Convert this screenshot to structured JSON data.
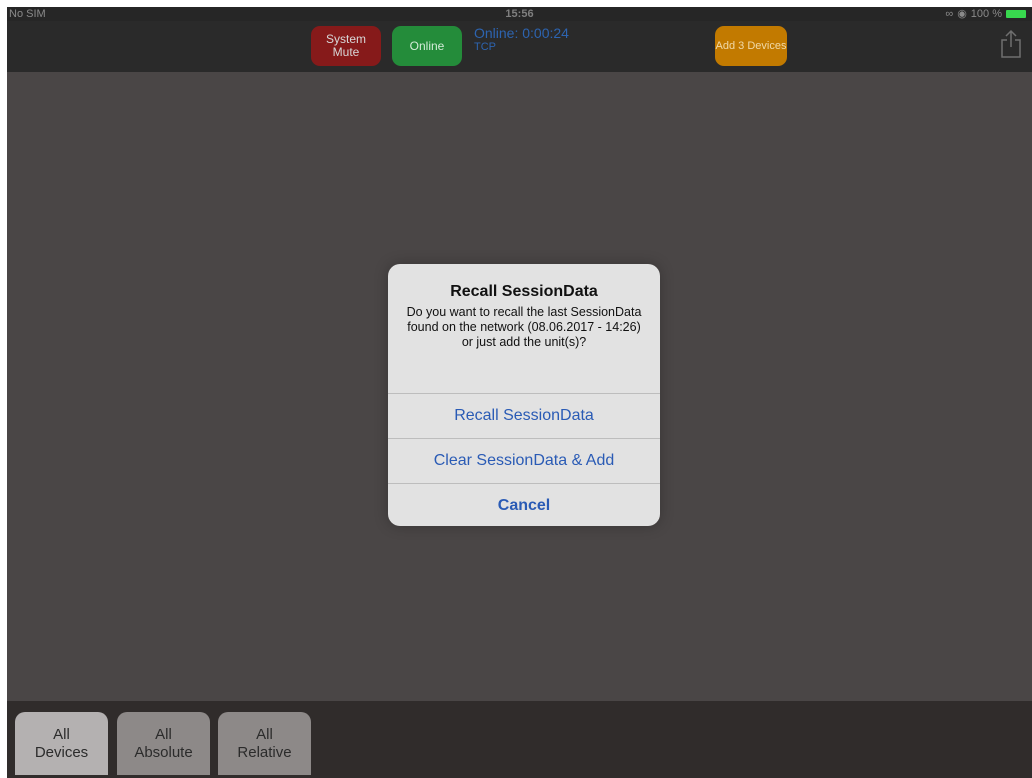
{
  "status_bar": {
    "carrier": "No SIM",
    "time": "15:56",
    "battery_text": "100 %",
    "battery_color": "#38d84e"
  },
  "toolbar": {
    "system_mute_label": "System Mute",
    "online_label": "Online",
    "online_status": "Online: 0:00:24",
    "protocol": "TCP",
    "add_devices_label": "Add 3 Devices",
    "share_icon": "share-icon",
    "colors": {
      "mute": "#861a1a",
      "online": "#248c3a",
      "add": "#c27a00",
      "online_text": "#2d64b0"
    }
  },
  "alert": {
    "title": "Recall SessionData",
    "message": "Do you want to recall the last SessionData found on the network (08.06.2017 - 14:26) or just add the unit(s)?",
    "actions": [
      {
        "label": "Recall SessionData"
      },
      {
        "label": "Clear SessionData & Add"
      },
      {
        "label": "Cancel"
      }
    ],
    "action_color": "#2a5bb5"
  },
  "bottom_tabs": [
    {
      "label": "All Devices",
      "active": true
    },
    {
      "label": "All Absolute",
      "active": false
    },
    {
      "label": "All Relative",
      "active": false
    }
  ]
}
